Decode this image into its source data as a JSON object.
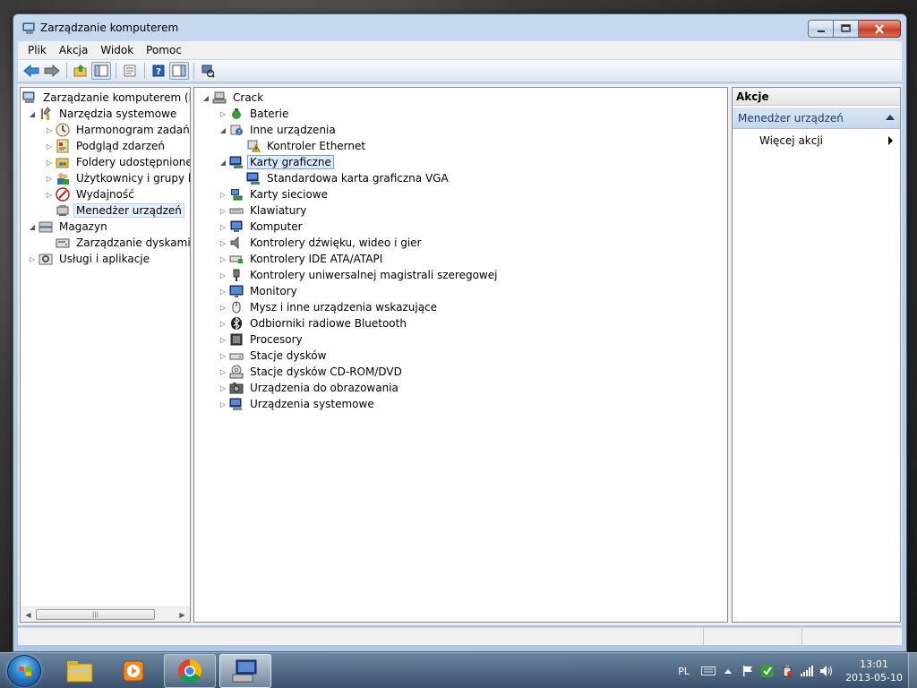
{
  "window": {
    "title": "Zarządzanie komputerem",
    "controls": {
      "minimize": "minimize",
      "maximize": "maximize",
      "close": "close"
    }
  },
  "menu": [
    "Plik",
    "Akcja",
    "Widok",
    "Pomoc"
  ],
  "toolbar": {
    "buttons": [
      "back-icon",
      "forward-icon",
      "up-folder-icon",
      "show-hide-tree-icon",
      "properties-icon",
      "help-icon",
      "show-hide-action-pane-icon",
      "scan-hardware-icon"
    ]
  },
  "left_tree": {
    "items": [
      {
        "label": "Zarządzanie komputerem (lokalne)",
        "icon": "computer-management-icon",
        "level": 0,
        "expander": "none"
      },
      {
        "label": "Narzędzia systemowe",
        "icon": "tools-icon",
        "level": 1,
        "expander": "expanded"
      },
      {
        "label": "Harmonogram zadań",
        "icon": "clock-icon",
        "level": 2,
        "expander": "collapsed"
      },
      {
        "label": "Podgląd zdarzeń",
        "icon": "event-viewer-icon",
        "level": 2,
        "expander": "collapsed"
      },
      {
        "label": "Foldery udostępnione",
        "icon": "shared-folder-icon",
        "level": 2,
        "expander": "collapsed"
      },
      {
        "label": "Użytkownicy i grupy lokalne",
        "icon": "users-icon",
        "level": 2,
        "expander": "collapsed"
      },
      {
        "label": "Wydajność",
        "icon": "performance-icon",
        "level": 2,
        "expander": "collapsed"
      },
      {
        "label": "Menedżer urządzeń",
        "icon": "device-manager-icon",
        "level": 2,
        "expander": "none",
        "selected": true
      },
      {
        "label": "Magazyn",
        "icon": "storage-icon",
        "level": 1,
        "expander": "expanded"
      },
      {
        "label": "Zarządzanie dyskami",
        "icon": "disk-management-icon",
        "level": 2,
        "expander": "none"
      },
      {
        "label": "Usługi i aplikacje",
        "icon": "services-icon",
        "level": 1,
        "expander": "collapsed"
      }
    ]
  },
  "device_tree": {
    "root": "Crack",
    "items": [
      {
        "label": "Baterie",
        "icon": "battery-icon",
        "level": 1,
        "expander": "collapsed"
      },
      {
        "label": "Inne urządzenia",
        "icon": "unknown-device-icon",
        "level": 1,
        "expander": "expanded"
      },
      {
        "label": "Kontroler Ethernet",
        "icon": "warning-device-icon",
        "level": 2,
        "expander": "none"
      },
      {
        "label": "Karty graficzne",
        "icon": "display-adapter-icon",
        "level": 1,
        "expander": "expanded",
        "focused": true
      },
      {
        "label": "Standardowa karta graficzna VGA",
        "icon": "display-adapter-icon",
        "level": 2,
        "expander": "none"
      },
      {
        "label": "Karty sieciowe",
        "icon": "network-adapter-icon",
        "level": 1,
        "expander": "collapsed"
      },
      {
        "label": "Klawiatury",
        "icon": "keyboard-icon",
        "level": 1,
        "expander": "collapsed"
      },
      {
        "label": "Komputer",
        "icon": "monitor-icon",
        "level": 1,
        "expander": "collapsed"
      },
      {
        "label": "Kontrolery dźwięku, wideo i gier",
        "icon": "speaker-icon",
        "level": 1,
        "expander": "collapsed"
      },
      {
        "label": "Kontrolery IDE ATA/ATAPI",
        "icon": "ide-controller-icon",
        "level": 1,
        "expander": "collapsed"
      },
      {
        "label": "Kontrolery uniwersalnej magistrali szeregowej",
        "icon": "usb-icon",
        "level": 1,
        "expander": "collapsed"
      },
      {
        "label": "Monitory",
        "icon": "monitor-icon",
        "level": 1,
        "expander": "collapsed"
      },
      {
        "label": "Mysz i inne urządzenia wskazujące",
        "icon": "mouse-icon",
        "level": 1,
        "expander": "collapsed"
      },
      {
        "label": "Odbiorniki radiowe Bluetooth",
        "icon": "bluetooth-icon",
        "level": 1,
        "expander": "collapsed"
      },
      {
        "label": "Procesory",
        "icon": "processor-icon",
        "level": 1,
        "expander": "collapsed"
      },
      {
        "label": "Stacje dysków",
        "icon": "disk-drive-icon",
        "level": 1,
        "expander": "collapsed"
      },
      {
        "label": "Stacje dysków CD-ROM/DVD",
        "icon": "cdrom-icon",
        "level": 1,
        "expander": "collapsed"
      },
      {
        "label": "Urządzenia do obrazowania",
        "icon": "camera-icon",
        "level": 1,
        "expander": "collapsed"
      },
      {
        "label": "Urządzenia systemowe",
        "icon": "system-device-icon",
        "level": 1,
        "expander": "collapsed"
      }
    ]
  },
  "actions": {
    "header": "Akcje",
    "section": "Menedżer urządzeń",
    "items": [
      "Więcej akcji"
    ]
  },
  "taskbar": {
    "pinned": [
      "explorer-icon",
      "media-player-icon",
      "chrome-icon",
      "computer-management-icon"
    ],
    "language": "PL",
    "time": "13:01",
    "date": "2013-05-10"
  },
  "colors": {
    "selection_bg": "#e5eef9",
    "focus_border": "#7da2ce",
    "actions_section": "#c5d6ec",
    "titlebar": "#b9cde6"
  }
}
